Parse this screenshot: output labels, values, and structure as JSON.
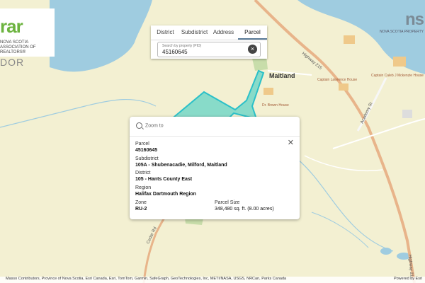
{
  "map": {
    "place_labels": {
      "maitland": "Maitland",
      "highway_215_north": "Highway 215",
      "highway_215_south": "Highway 215",
      "academy_st": "Academy St",
      "cedar_rd": "Cedar Rd",
      "captain_douglas_house": "Dr. Brown House",
      "captain_lawrence_house": "Captain Lawrence House",
      "captain_museum": "Captain Caleb J Mckenzie House"
    },
    "colors": {
      "land": "#f3f0d2",
      "water": "#9fcce0",
      "road": "#e8b48a",
      "parcel": "#4fd0c4",
      "green": "#c8ddaa"
    }
  },
  "brand": {
    "logo_text": "rar",
    "subtitle": "NOVA SCOTIA ASSOCIATION OF REALTORS®",
    "bottom_text": "DOR"
  },
  "ns_logo": {
    "main": "ns",
    "sub": "NOVA SCOTIA PROPERTY"
  },
  "search": {
    "tabs": [
      "District",
      "Subdistrict",
      "Address",
      "Parcel"
    ],
    "active_tab": "Parcel",
    "placeholder": "Search by property (PID)",
    "value": "45160645",
    "clear_icon": "close-circle-icon"
  },
  "popup": {
    "zoom_label": "Zoom to",
    "parcel_label": "Parcel",
    "parcel_value": "45160645",
    "subdistrict_label": "Subdistrict",
    "subdistrict_value": "105A - Shubenacadie, Milford, Maitland",
    "district_label": "District",
    "district_value": "105 - Hants County East",
    "region_label": "Region",
    "region_value": "Halifax Dartmouth Region",
    "zone_label": "Zone",
    "zone_value": "RU-2",
    "size_label": "Parcel Size",
    "size_value": "348,480 sq. ft. (8.00 acres)"
  },
  "footer": {
    "attribution": "Masso Contributors, Province of Nova Scotia, Esri Canada, Esri, TomTom, Garmin, SafeGraph, GeoTechnologies, Inc, METI/NASA, USGS, NRCan, Parks Canada",
    "powered": "Powered by Esri"
  }
}
